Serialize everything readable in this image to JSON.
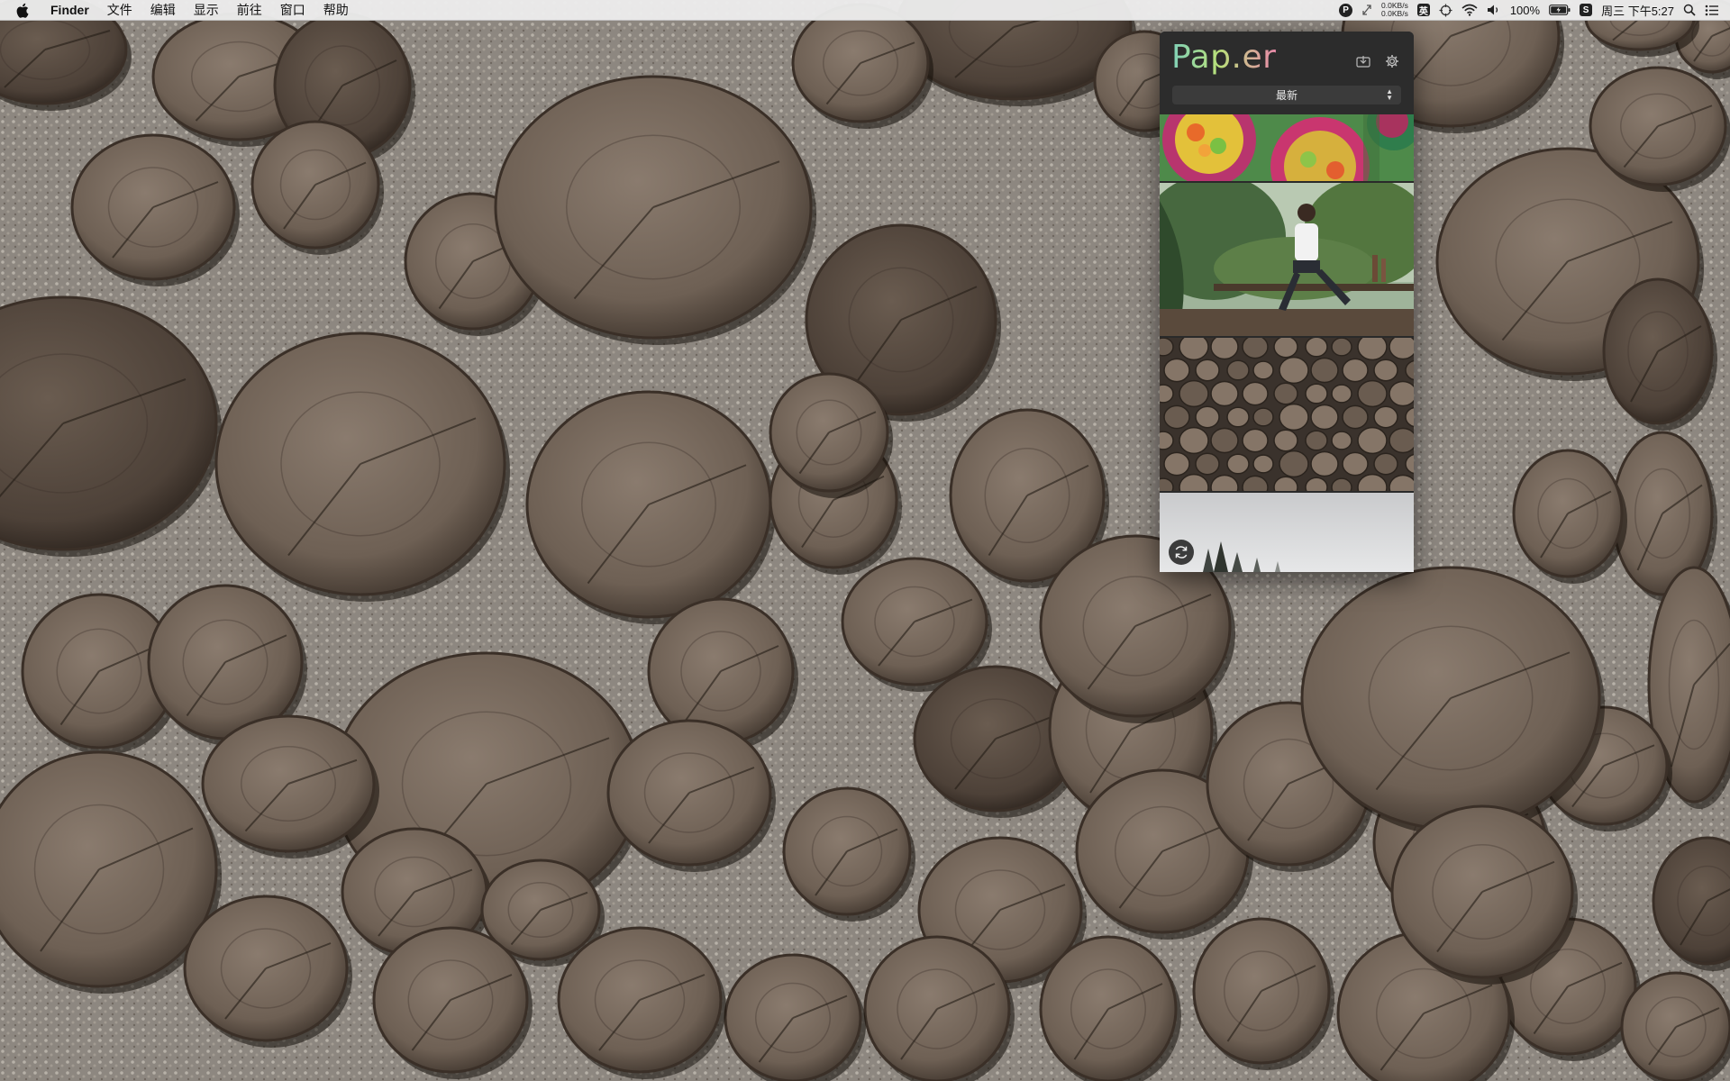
{
  "menubar": {
    "app_name": "Finder",
    "menus": [
      "文件",
      "编辑",
      "显示",
      "前往",
      "窗口",
      "帮助"
    ],
    "status": {
      "net_up": "0.0KB/s",
      "net_down": "0.0KB/s",
      "input_method": "英",
      "battery_percent": "100%",
      "clock": "周三 下午5:27",
      "p_badge": "P",
      "s_badge": "S"
    }
  },
  "paper": {
    "logo": "Pap.er",
    "sort_label": "最新",
    "icons": {
      "download": "download-icon",
      "settings": "gear-icon",
      "refresh": "refresh-icon"
    },
    "thumbnails": [
      "colorful salad bowls",
      "man sitting on fence in garden",
      "stacked log ends",
      "misty treetops sky"
    ]
  }
}
